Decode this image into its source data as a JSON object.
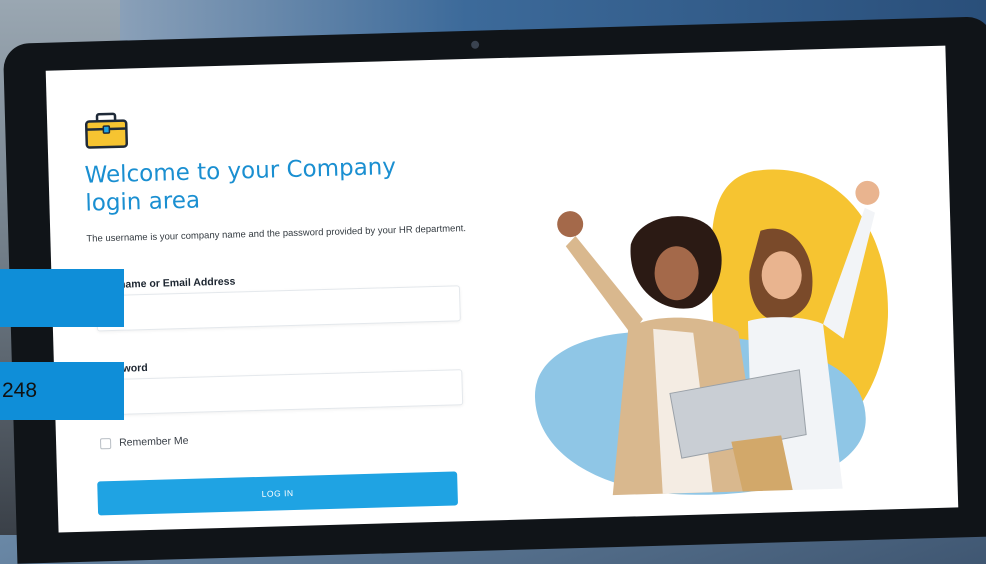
{
  "login": {
    "title": "Welcome to your Company login area",
    "subtitle": "The username is your company name and the password provided by your HR department.",
    "username_label": "Username or Email Address",
    "username_value": "",
    "password_label": "Password",
    "password_value": "",
    "remember_label": "Remember Me",
    "remember_checked": false,
    "button_label": "LOG IN"
  },
  "overlay": {
    "number": "248"
  },
  "colors": {
    "accent": "#1fa3e3",
    "title": "#1a8fd1",
    "blob_yellow": "#f6c431",
    "blob_blue": "#8fc6e6",
    "overlay_blue": "#0f8ed8"
  },
  "icons": {
    "brand": "briefcase-icon"
  }
}
